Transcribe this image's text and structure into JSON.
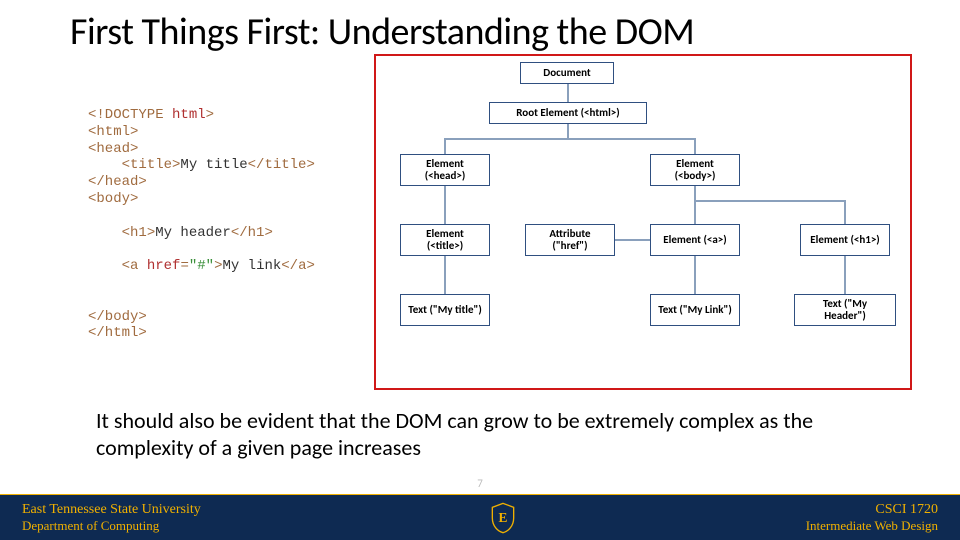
{
  "slide": {
    "title": "First Things First: Understanding the DOM",
    "body_text": "It should also be evident that the DOM can grow to be extremely complex as the complexity of a given page increases",
    "page_number": "7"
  },
  "code": {
    "l1_a": "<!DOCTYPE ",
    "l1_b": "html",
    "l1_c": ">",
    "l2": "<html>",
    "l3": "<head>",
    "l4_open": "<title>",
    "l4_text": "My title",
    "l4_close": "</title>",
    "l5": "</head>",
    "l6": "<body>",
    "blank": "",
    "l8_open": "<h1>",
    "l8_text": "My header",
    "l8_close": "</h1>",
    "blank2": "",
    "l10_a": "<a ",
    "l10_attr": "href",
    "l10_eq": "=",
    "l10_val": "\"#\"",
    "l10_b": ">",
    "l10_text": "My link",
    "l10_c": "</a>",
    "blank3": "",
    "blank4": "",
    "l13": "</body>",
    "l14": "</html>"
  },
  "diagram": {
    "document": "Document",
    "root": "Root Element (<html>)",
    "head": "Element (<head>)",
    "body": "Element (<body>)",
    "title_el": "Element (<title>)",
    "href": "Attribute (\"href\")",
    "a_el": "Element (<a>)",
    "h1_el": "Element (<h1>)",
    "txt_title": "Text (\"My title\")",
    "txt_link": "Text (\"My Link\")",
    "txt_header": "Text (\"My Header\")"
  },
  "footer": {
    "uni": "East Tennessee State University",
    "dept": "Department of Computing",
    "course": "CSCI 1720",
    "course_name": "Intermediate Web Design",
    "shield_letter": "E"
  }
}
